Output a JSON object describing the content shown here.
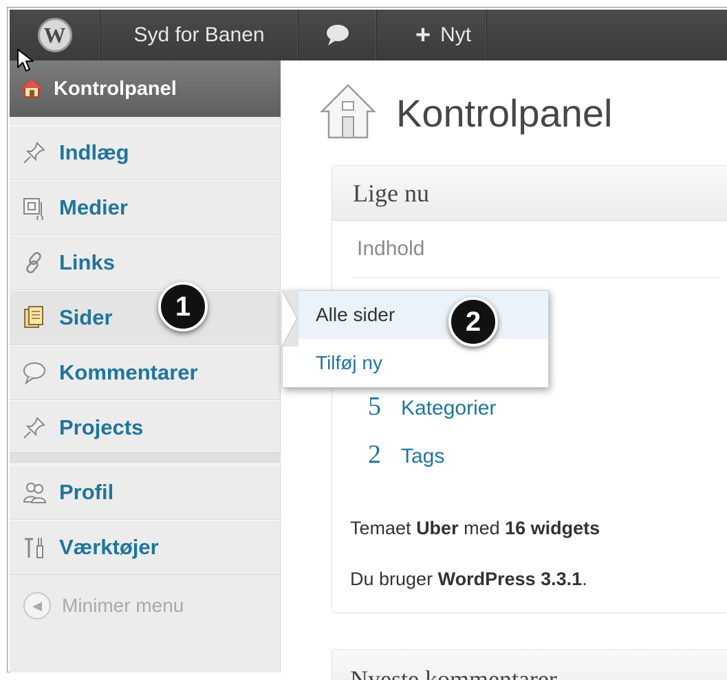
{
  "adminbar": {
    "site_name": "Syd for Banen",
    "new_label": "Nyt"
  },
  "sidebar": {
    "dashboard_label": "Kontrolpanel",
    "items": [
      {
        "label": "Indlæg",
        "icon": "pushpin-icon"
      },
      {
        "label": "Medier",
        "icon": "media-icon"
      },
      {
        "label": "Links",
        "icon": "link-icon"
      },
      {
        "label": "Sider",
        "icon": "pages-icon"
      },
      {
        "label": "Kommentarer",
        "icon": "comment-bubble-icon"
      },
      {
        "label": "Projects",
        "icon": "pushpin-icon"
      },
      {
        "label": "Profil",
        "icon": "users-icon"
      },
      {
        "label": "Værktøjer",
        "icon": "tools-icon"
      }
    ],
    "collapse_label": "Minimer menu"
  },
  "flyout": {
    "all_pages": "Alle sider",
    "add_new": "Tilføj ny"
  },
  "callouts": {
    "one": "1",
    "two": "2"
  },
  "main": {
    "title": "Kontrolpanel",
    "right_now": {
      "title": "Lige nu",
      "content_label": "Indhold",
      "stats": [
        {
          "num": "5",
          "label": "Kategorier"
        },
        {
          "num": "2",
          "label": "Tags"
        }
      ],
      "theme_prefix": "Temaet",
      "theme_name": "Uber",
      "theme_mid": "med",
      "widgets_text": "16 widgets",
      "version_prefix": "Du bruger",
      "version_name": "WordPress 3.3.1",
      "version_suffix": "."
    },
    "recent_title": "Nyeste kommentarer"
  },
  "colors": {
    "link_blue": "#21759b",
    "adminbar_bg": "#3b3b3b",
    "sidebar_bg": "#ececec",
    "active_menu_bg": "#6c6c6c"
  }
}
